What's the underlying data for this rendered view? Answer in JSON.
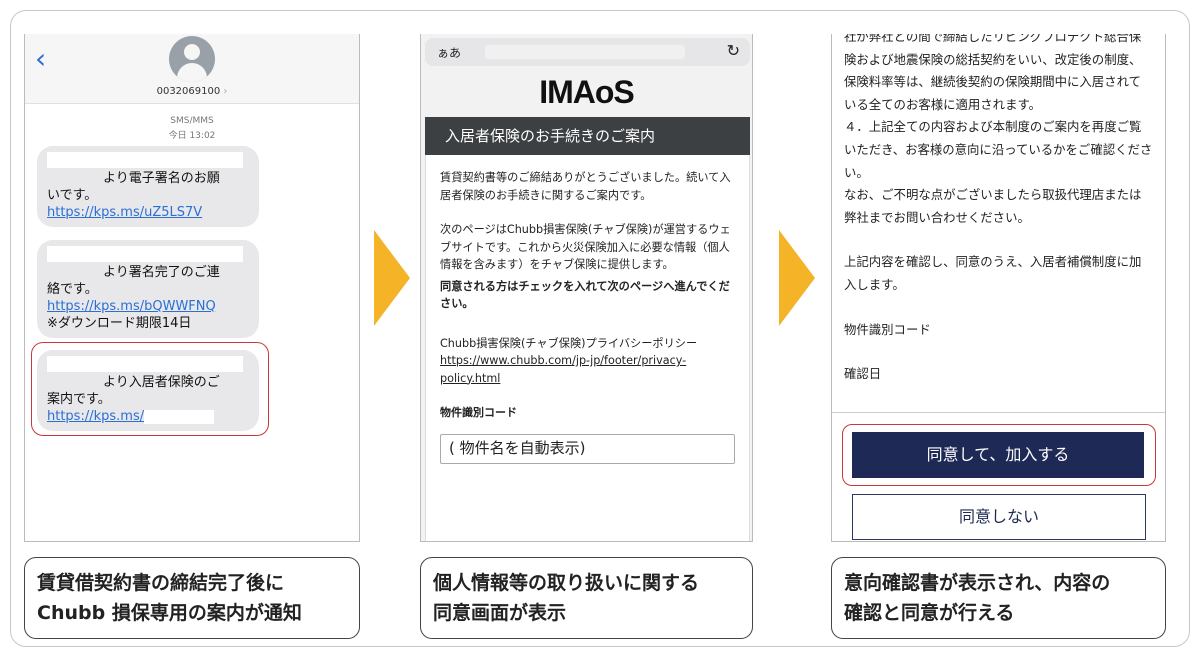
{
  "sms": {
    "contact_number": "0032069100",
    "contact_chevron": "›",
    "meta_type": "SMS/MMS",
    "meta_time": "今日 13:02",
    "messages": [
      {
        "lines": [
          "より電子署名のお願",
          "いです。"
        ],
        "link": "https://kps.ms/uZ5LS7V"
      },
      {
        "lines": [
          "より署名完了のご連",
          "絡です。"
        ],
        "link": "https://kps.ms/bQWWFNQ",
        "note": "※ダウンロード期限14日"
      },
      {
        "lines": [
          "より入居者保険のご",
          "案内です。"
        ],
        "link": "https://kps.ms/"
      }
    ]
  },
  "browser": {
    "font_toggle": "ぁあ",
    "brand": "IMAoS",
    "banner_title": "入居者保険のお手続きのご案内",
    "para1": "賃貸契約書等のご締結ありがとうございました。続いて入居者保険のお手続きに関するご案内です。",
    "para2": "次のページはChubb損害保険(チャブ保険)が運営するウェブサイトです。これから火災保険加入に必要な情報（個人情報を含みます）をチャブ保険に提供します。",
    "para2_bold": "同意される方はチェックを入れて次のページへ進んでください。",
    "privacy_label": "Chubb損害保険(チャブ保険)プライバシーポリシー",
    "privacy_link": "https://www.chubb.com/jp-jp/footer/privacy-policy.html",
    "code_label": "物件識別コード",
    "code_value": "( 物件名を自動表示)"
  },
  "confirm": {
    "p1": "社が弊社との間で締結したリビングプロテクト総合保険および地震保険の総括契約をいい、改定後の制度、保険料率等は、継続後契約の保険期間中に入居されている全てのお客様に適用されます。",
    "p2": "４．上記全ての内容および本制度のご案内を再度ご覧いただき、お客様の意向に沿っているかをご確認ください。",
    "p3": "なお、ご不明な点がございましたら取扱代理店または弊社までお問い合わせください。",
    "p4": "上記内容を確認し、同意のうえ、入居者補償制度に加入します。",
    "code_label": "物件識別コード",
    "date_label": "確認日",
    "agree_button": "同意して、加入する",
    "decline_button": "同意しない"
  },
  "captions": [
    {
      "line1": "賃貸借契約書の締結完了後に",
      "line2": "Chubb 損保専用の案内が通知"
    },
    {
      "line1": "個人情報等の取り扱いに関する",
      "line2": "同意画面が表示"
    },
    {
      "line1": "意向確認書が表示され、内容の",
      "line2": "確認と同意が行える"
    }
  ],
  "colors": {
    "arrow": "#f5b428",
    "agree_button": "#1e2a55",
    "highlight": "#c9383a",
    "link": "#2a6fd6"
  }
}
